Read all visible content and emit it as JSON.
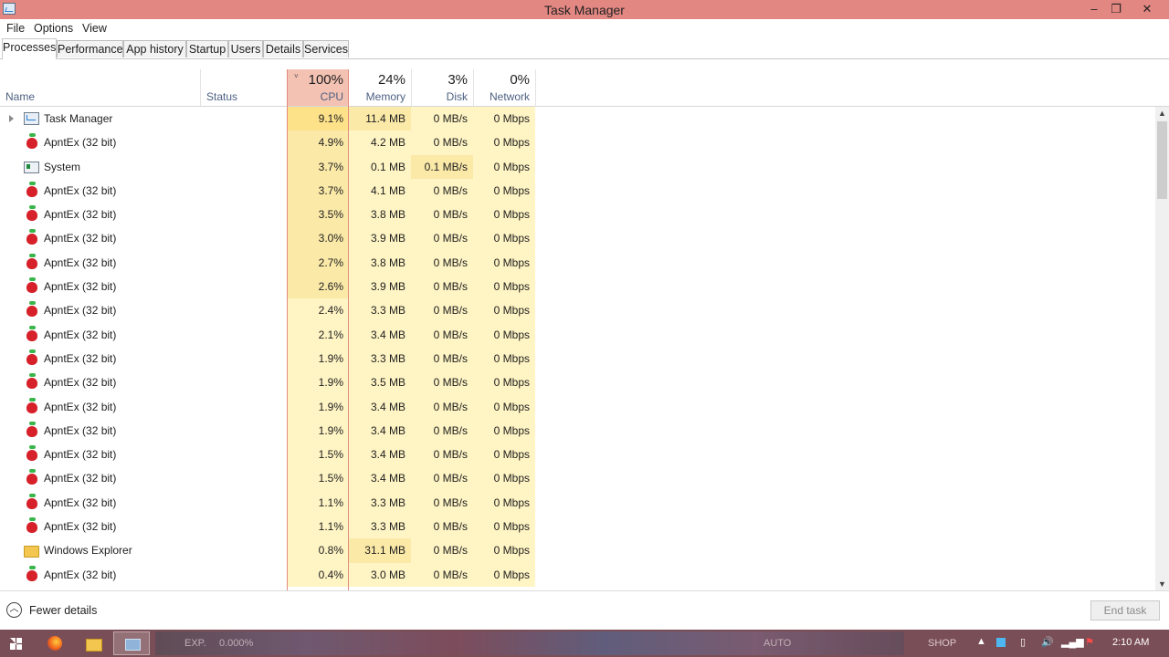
{
  "window": {
    "title": "Task Manager"
  },
  "menu": [
    "File",
    "Options",
    "View"
  ],
  "tabs": [
    "Processes",
    "Performance",
    "App history",
    "Startup",
    "Users",
    "Details",
    "Services"
  ],
  "active_tab": "Processes",
  "columns": {
    "name": "Name",
    "status": "Status",
    "cpu": {
      "pct": "100%",
      "label": "CPU"
    },
    "memory": {
      "pct": "24%",
      "label": "Memory"
    },
    "disk": {
      "pct": "3%",
      "label": "Disk"
    },
    "network": {
      "pct": "0%",
      "label": "Network"
    }
  },
  "rows": [
    {
      "name": "Task Manager",
      "icon": "task-manager-icon",
      "cpu": "9.1%",
      "mem": "11.4 MB",
      "disk": "0 MB/s",
      "net": "0 Mbps"
    },
    {
      "name": "ApntEx (32 bit)",
      "icon": "apple-icon",
      "cpu": "4.9%",
      "mem": "4.2 MB",
      "disk": "0 MB/s",
      "net": "0 Mbps"
    },
    {
      "name": "System",
      "icon": "system-icon",
      "cpu": "3.7%",
      "mem": "0.1 MB",
      "disk": "0.1 MB/s",
      "net": "0 Mbps"
    },
    {
      "name": "ApntEx (32 bit)",
      "icon": "apple-icon",
      "cpu": "3.7%",
      "mem": "4.1 MB",
      "disk": "0 MB/s",
      "net": "0 Mbps"
    },
    {
      "name": "ApntEx (32 bit)",
      "icon": "apple-icon",
      "cpu": "3.5%",
      "mem": "3.8 MB",
      "disk": "0 MB/s",
      "net": "0 Mbps"
    },
    {
      "name": "ApntEx (32 bit)",
      "icon": "apple-icon",
      "cpu": "3.0%",
      "mem": "3.9 MB",
      "disk": "0 MB/s",
      "net": "0 Mbps"
    },
    {
      "name": "ApntEx (32 bit)",
      "icon": "apple-icon",
      "cpu": "2.7%",
      "mem": "3.8 MB",
      "disk": "0 MB/s",
      "net": "0 Mbps"
    },
    {
      "name": "ApntEx (32 bit)",
      "icon": "apple-icon",
      "cpu": "2.6%",
      "mem": "3.9 MB",
      "disk": "0 MB/s",
      "net": "0 Mbps"
    },
    {
      "name": "ApntEx (32 bit)",
      "icon": "apple-icon",
      "cpu": "2.4%",
      "mem": "3.3 MB",
      "disk": "0 MB/s",
      "net": "0 Mbps"
    },
    {
      "name": "ApntEx (32 bit)",
      "icon": "apple-icon",
      "cpu": "2.1%",
      "mem": "3.4 MB",
      "disk": "0 MB/s",
      "net": "0 Mbps"
    },
    {
      "name": "ApntEx (32 bit)",
      "icon": "apple-icon",
      "cpu": "1.9%",
      "mem": "3.3 MB",
      "disk": "0 MB/s",
      "net": "0 Mbps"
    },
    {
      "name": "ApntEx (32 bit)",
      "icon": "apple-icon",
      "cpu": "1.9%",
      "mem": "3.5 MB",
      "disk": "0 MB/s",
      "net": "0 Mbps"
    },
    {
      "name": "ApntEx (32 bit)",
      "icon": "apple-icon",
      "cpu": "1.9%",
      "mem": "3.4 MB",
      "disk": "0 MB/s",
      "net": "0 Mbps"
    },
    {
      "name": "ApntEx (32 bit)",
      "icon": "apple-icon",
      "cpu": "1.9%",
      "mem": "3.4 MB",
      "disk": "0 MB/s",
      "net": "0 Mbps"
    },
    {
      "name": "ApntEx (32 bit)",
      "icon": "apple-icon",
      "cpu": "1.5%",
      "mem": "3.4 MB",
      "disk": "0 MB/s",
      "net": "0 Mbps"
    },
    {
      "name": "ApntEx (32 bit)",
      "icon": "apple-icon",
      "cpu": "1.5%",
      "mem": "3.4 MB",
      "disk": "0 MB/s",
      "net": "0 Mbps"
    },
    {
      "name": "ApntEx (32 bit)",
      "icon": "apple-icon",
      "cpu": "1.1%",
      "mem": "3.3 MB",
      "disk": "0 MB/s",
      "net": "0 Mbps"
    },
    {
      "name": "ApntEx (32 bit)",
      "icon": "apple-icon",
      "cpu": "1.1%",
      "mem": "3.3 MB",
      "disk": "0 MB/s",
      "net": "0 Mbps"
    },
    {
      "name": "Windows Explorer",
      "icon": "folder-icon",
      "cpu": "0.8%",
      "mem": "31.1 MB",
      "disk": "0 MB/s",
      "net": "0 Mbps"
    },
    {
      "name": "ApntEx (32 bit)",
      "icon": "apple-icon",
      "cpu": "0.4%",
      "mem": "3.0 MB",
      "disk": "0 MB/s",
      "net": "0 Mbps"
    }
  ],
  "footer": {
    "fewer_details": "Fewer details",
    "end_task": "End task"
  },
  "taskbar": {
    "clock": "2:10 AM",
    "game_exp": "EXP.",
    "game_exp_value": "0.000%",
    "game_auto": "AUTO",
    "game_shop": "SHOP"
  },
  "colors": {
    "title_bar": "#e38782",
    "cpu_header": "#f4c2b3",
    "heat_high": "#fde28a",
    "heat_mid": "#fbe9a8",
    "heat_low": "#fff4c4",
    "taskbar": "#7a4e56"
  }
}
